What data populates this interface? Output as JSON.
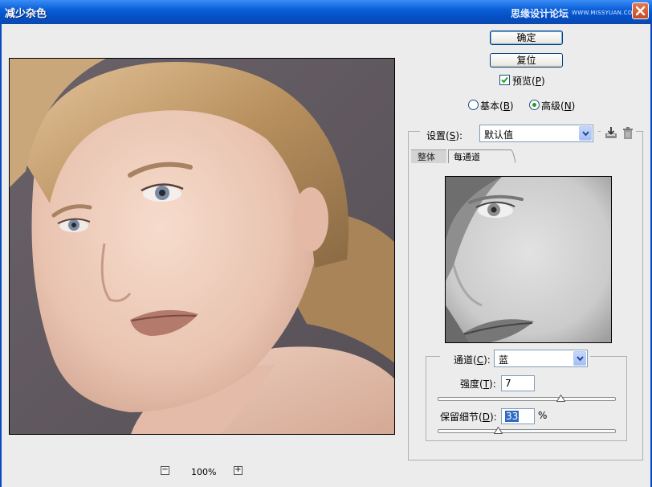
{
  "window": {
    "title": "减少杂色",
    "watermark": "思缘设计论坛",
    "watermark_url": "WWW.MISSYUAN.COM"
  },
  "preview": {
    "zoom_level": "100%"
  },
  "buttons": {
    "ok": "确定",
    "reset": "复位"
  },
  "preview_checkbox": {
    "label": "预览(",
    "hotkey": "P",
    "suffix": ")",
    "checked": true
  },
  "mode": {
    "basic_label": "基本(",
    "basic_hotkey": "B",
    "advanced_label": "高级(",
    "advanced_hotkey": "N",
    "close": ")",
    "selected": "advanced"
  },
  "settings": {
    "label": "设置(",
    "hotkey": "S",
    "close": "):",
    "value": "默认值"
  },
  "tabs": [
    {
      "label": "整体",
      "active": false
    },
    {
      "label": "每通道",
      "active": true
    }
  ],
  "channel": {
    "label": "通道(",
    "hotkey": "C",
    "close": "):",
    "value": "蓝"
  },
  "strength": {
    "label": "强度(",
    "hotkey": "T",
    "close": "):",
    "value": "7",
    "max": 10
  },
  "preserve_details": {
    "label": "保留细节(",
    "hotkey": "D",
    "close": "):",
    "value": "33",
    "unit": "%",
    "max": 100
  },
  "colors": {
    "title_blue": "#0a5fd8",
    "selection_blue": "#316ac5",
    "radio_dot": "#1f9f1f"
  }
}
